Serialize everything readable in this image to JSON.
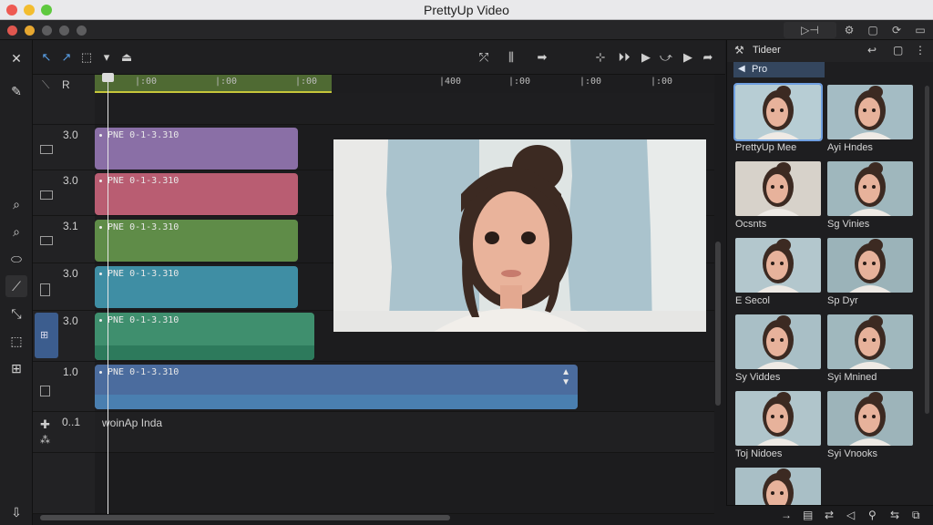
{
  "window": {
    "title": "PrettyUp Video",
    "traffic_colors": [
      "#ee5a52",
      "#f3bd2f",
      "#5fc93f"
    ]
  },
  "appbar": {
    "dots": [
      "#e0574f",
      "#e6a730",
      "#6a6a6c",
      "#6a6a6c",
      "#6a6a6c"
    ],
    "right_buttons": [
      "▷⊣",
      "⚙",
      "▢",
      "⟳",
      "▭"
    ]
  },
  "left_tools": [
    {
      "icon": "close-icon",
      "glyph": "✕"
    },
    {
      "icon": "pencil-icon",
      "glyph": "✎"
    },
    {
      "icon": "search-icon",
      "glyph": "⌕"
    },
    {
      "icon": "zoom-icon",
      "glyph": "⌕"
    },
    {
      "icon": "eraser-icon",
      "glyph": "⬭"
    },
    {
      "icon": "brush-icon",
      "glyph": "⟋"
    },
    {
      "icon": "resize-icon",
      "glyph": "⤡"
    },
    {
      "icon": "select-icon",
      "glyph": "⬚"
    },
    {
      "icon": "grid-icon",
      "glyph": "⊞"
    },
    {
      "icon": "import-icon",
      "glyph": "⇩"
    }
  ],
  "toolbar": {
    "left": [
      "↖",
      "↗",
      "⬚",
      "▾",
      "⏏"
    ],
    "middle": [
      "⤱",
      "⫼",
      "➡"
    ],
    "right": [
      "⊹",
      "⏵⏵",
      "▶",
      "⤻",
      "▶",
      "➦"
    ]
  },
  "ruler": {
    "ticks": [
      "|:00",
      "|:00",
      "|:00",
      "|400",
      "|:00",
      "|:00",
      "|:00"
    ],
    "header_label": "R"
  },
  "tracks": [
    {
      "num": "3.0",
      "clip": "PNE 0-1-3.310",
      "color": "#8a6fa6"
    },
    {
      "num": "3.0",
      "clip": "PNE 0-1-3.310",
      "color": "#b95d72"
    },
    {
      "num": "3.1",
      "clip": "PNE 0-1-3.310",
      "color": "#5f8c48"
    },
    {
      "num": "3.0",
      "clip": "PNE 0-1-3.310",
      "color": "#3f8ea4"
    },
    {
      "num": "3.0",
      "clip": "PNE 0-1-3.310",
      "color": "#3f8f6e"
    },
    {
      "num": "1.0",
      "clip": "PNE 0-1-3.310",
      "color": "#4b6c9e"
    },
    {
      "num": "0..1",
      "clip": "woinAp Inda",
      "color": "#1f1f21"
    }
  ],
  "panel": {
    "tab": "Tideer",
    "subtab": "Pro",
    "thumbs": [
      {
        "label": "PrettyUp Mee"
      },
      {
        "label": "Ayi Hndes"
      },
      {
        "label": "Ocsnts"
      },
      {
        "label": "Sg Vinies"
      },
      {
        "label": "E Secol"
      },
      {
        "label": "Sp Dyr"
      },
      {
        "label": "Sy Viddes"
      },
      {
        "label": "Syi Mnined"
      },
      {
        "label": "Toj Nidoes"
      },
      {
        "label": "Syi Vnooks"
      },
      {
        "label": ""
      }
    ],
    "footer": [
      "→",
      "▤",
      "⇄",
      "◁",
      "⚲",
      "⇆",
      "⧉"
    ]
  }
}
